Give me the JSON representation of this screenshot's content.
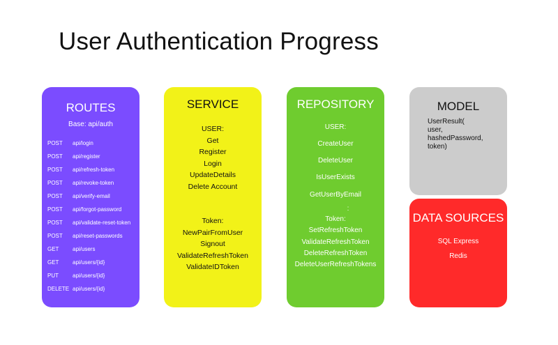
{
  "title": "User Authentication Progress",
  "routes": {
    "title": "ROUTES",
    "base": "Base: api/auth",
    "items": [
      {
        "method": "POST",
        "path": "api/login"
      },
      {
        "method": "POST",
        "path": "api/register"
      },
      {
        "method": "POST",
        "path": "api/refresh-token"
      },
      {
        "method": "POST",
        "path": "api/revoke-token"
      },
      {
        "method": "POST",
        "path": "api/verify-email"
      },
      {
        "method": "POST",
        "path": "api/forgot-password"
      },
      {
        "method": "POST",
        "path": "api/validate-reset-token"
      },
      {
        "method": "POST",
        "path": "api/reset-passwords"
      },
      {
        "method": "GET",
        "path": "api/users"
      },
      {
        "method": "GET",
        "path": "api/users/{id}"
      },
      {
        "method": "PUT",
        "path": "api/users/{id}"
      },
      {
        "method": "DELETE",
        "path": "api/users/{id}"
      }
    ]
  },
  "service": {
    "title": "SERVICE",
    "user_header": "USER:",
    "user_items": [
      "Get",
      "Register",
      "Login",
      "UpdateDetails",
      "Delete Account"
    ],
    "token_header": "Token:",
    "token_items": [
      "NewPairFromUser",
      "Signout",
      "ValidateRefreshToken",
      "ValidateIDToken"
    ]
  },
  "repository": {
    "title": "REPOSITORY",
    "user_header": "USER:",
    "user_items": [
      "CreateUser",
      "DeleteUser",
      "IsUserExists",
      "GetUserByEmail"
    ],
    "separator": ":",
    "token_header": "Token:",
    "token_items": [
      "SetRefreshToken",
      "ValidateRefreshToken",
      "DeleteRefreshToken",
      "DeleteUserRefreshTokens"
    ]
  },
  "model": {
    "title": "MODEL",
    "lines": [
      "UserResult(",
      "user,",
      "hashedPassword,",
      "token)"
    ]
  },
  "datasources": {
    "title": "DATA SOURCES",
    "items": [
      "SQL Express",
      "Redis"
    ]
  }
}
